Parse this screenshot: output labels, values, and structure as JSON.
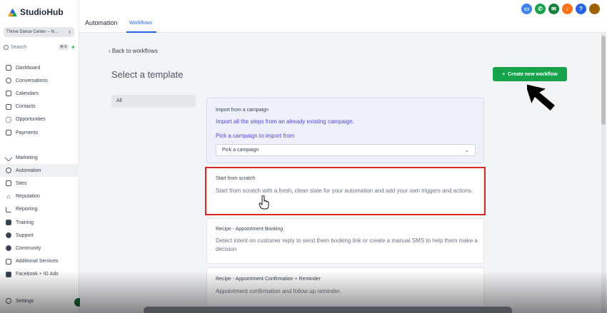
{
  "app": {
    "name": "StudioHub",
    "account": "Thrive Dance Center -- N...",
    "search_placeholder": "Search",
    "search_shortcut": "⌘ K"
  },
  "sidebar": {
    "items": [
      {
        "label": "Dashboard",
        "icon": "dashboard-icon"
      },
      {
        "label": "Conversations",
        "icon": "chat-icon"
      },
      {
        "label": "Calendars",
        "icon": "calendar-icon"
      },
      {
        "label": "Contacts",
        "icon": "contacts-icon"
      },
      {
        "label": "Opportunities",
        "icon": "opportunities-icon"
      },
      {
        "label": "Payments",
        "icon": "payments-icon"
      }
    ],
    "items2": [
      {
        "label": "Marketing",
        "icon": "send-icon"
      },
      {
        "label": "Automation",
        "icon": "automation-icon"
      },
      {
        "label": "Sites",
        "icon": "sites-icon"
      },
      {
        "label": "Reputation",
        "icon": "star-icon"
      },
      {
        "label": "Reporting",
        "icon": "chart-icon"
      },
      {
        "label": "Training",
        "icon": "book-icon"
      },
      {
        "label": "Support",
        "icon": "support-icon"
      },
      {
        "label": "Community",
        "icon": "community-icon"
      },
      {
        "label": "Additional Services",
        "icon": "services-icon"
      },
      {
        "label": "Facebook + IG Ads",
        "icon": "facebook-icon"
      }
    ],
    "settings": "Settings"
  },
  "header": {
    "title": "Automation",
    "tab": "Workflows"
  },
  "content": {
    "back": "Back to workflows",
    "title": "Select a template",
    "create_button": "Create new workflow",
    "filter_all": "All",
    "import": {
      "heading": "Import from a campaign",
      "desc": "Import all the steps from an already existing campaign.",
      "pick_label": "Pick a campaign to import from",
      "select_value": "Pick a campaign"
    },
    "scratch": {
      "heading": "Start from scratch",
      "desc": "Start from scratch with a fresh, clean slate for your automation and add your own triggers and actions."
    },
    "recipe1": {
      "heading": "Recipe - Appointment Booking",
      "desc": "Detect intent on customer reply to send them booking link or create a manual SMS to help them make a decision"
    },
    "recipe2": {
      "heading": "Recipe - Appointment Confirmation + Reminder",
      "desc": "Appointment confirmation and follow up reminder."
    }
  },
  "colors": {
    "accent": "#2563eb",
    "create": "#16a34a",
    "highlight": "#dc2626"
  }
}
